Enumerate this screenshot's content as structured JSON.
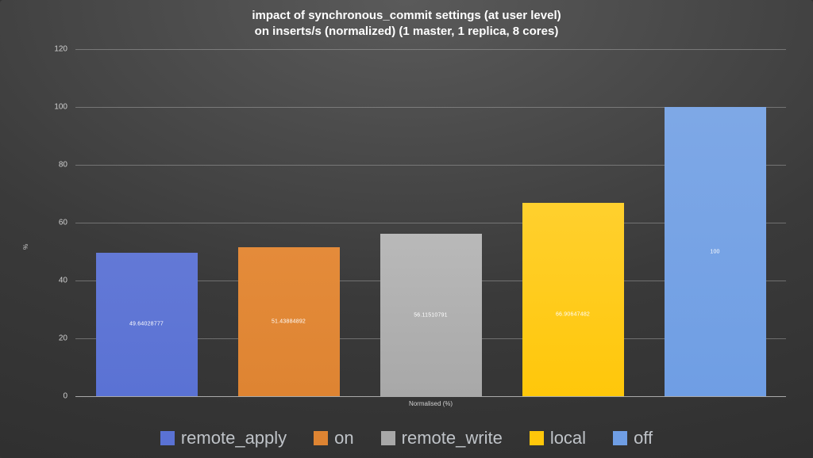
{
  "chart_data": {
    "type": "bar",
    "title_line1": "impact of synchronous_commit settings (at user level)",
    "title_line2": "on inserts/s (normalized) (1 master, 1 replica, 8 cores)",
    "ylabel": "%",
    "xlabel": "Normalised (%)",
    "ylim": [
      0,
      120
    ],
    "yticks": [
      0,
      20,
      40,
      60,
      80,
      100,
      120
    ],
    "categories": [
      "remote_apply",
      "on",
      "remote_write",
      "local",
      "off"
    ],
    "series": [
      {
        "name": "remote_apply",
        "value": 49.64028777,
        "color": "#5a72d4",
        "label": "49.64028777"
      },
      {
        "name": "on",
        "value": 51.43884892,
        "color": "#de8432",
        "label": "51.43884892"
      },
      {
        "name": "remote_write",
        "value": 56.11510791,
        "color": "#a8a8a8",
        "label": "56.11510791"
      },
      {
        "name": "local",
        "value": 66.90647482,
        "color": "#ffc70a",
        "label": "66.90647482"
      },
      {
        "name": "off",
        "value": 100,
        "color": "#6f9ee4",
        "label": "100"
      }
    ]
  },
  "legend": {
    "items": [
      "remote_apply",
      "on",
      "remote_write",
      "local",
      "off"
    ]
  }
}
